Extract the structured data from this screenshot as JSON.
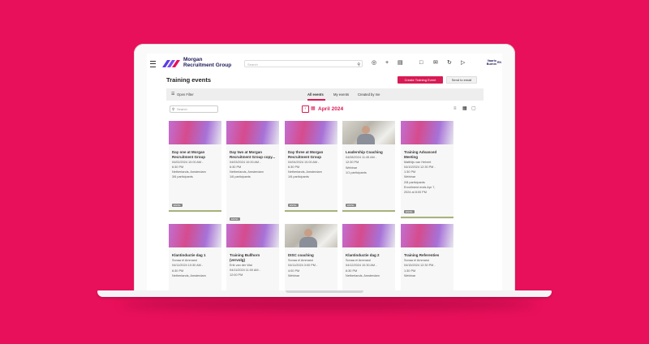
{
  "app": {
    "logo_line1": "Morgan",
    "logo_line2": "Recruitment Group",
    "search_placeholder": "Search",
    "user_line1": "Vaarlo",
    "user_line2": "Burnin",
    "language": "EN"
  },
  "header": {
    "title": "Training events",
    "create_label": "Create Training Event",
    "send_label": "Send to email"
  },
  "filter": {
    "open_filter": "Open Filter",
    "tabs": [
      "All events",
      "My events",
      "Created by me"
    ],
    "active_tab": 0
  },
  "toolbar": {
    "search_placeholder": "Search",
    "month": "April 2024"
  },
  "colors": {
    "accent": "#d81b55",
    "background": "#e8105a"
  },
  "cards": [
    {
      "title": "Day one at Morgan Recruitment Group",
      "lines": [
        "04/02/2024 10:00 AM -",
        "6:30 PM",
        "Netherlands, Amsterdam",
        "3/6 participants"
      ],
      "badge": "EN/NL",
      "image": "gradient"
    },
    {
      "title": "Day two at Morgan Recruitment Group copy...",
      "lines": [
        "04/03/2024 10:00 AM -",
        "6:30 PM",
        "Netherlands, Amsterdam",
        "1/6 participants"
      ],
      "badge": "EN/NL",
      "image": "gradient"
    },
    {
      "title": "Day three at Morgan Recruitment Group",
      "lines": [
        "04/04/2024 10:00 AM -",
        "6:30 PM",
        "Netherlands, Amsterdam",
        "1/6 participants"
      ],
      "badge": "EN/NL",
      "image": "gradient"
    },
    {
      "title": "Leadership Coaching",
      "lines": [
        "04/08/2024 11:45 AM -",
        "12:30 PM",
        "Webinar",
        "1/1 participants"
      ],
      "badge": "EN/NL",
      "image": "photo"
    },
    {
      "title": "Training Advanced Meeting",
      "lines": [
        "Matthijs van Helvert",
        "04/10/2024 12:30 PM -",
        "1:30 PM",
        "Webinar",
        "2/8 participants",
        "Enrollment ends Apr 7,",
        "2024 at 8:00 PM"
      ],
      "badge": "EN/NL",
      "image": "gradient"
    },
    {
      "title": "Klantinductie dag 1",
      "lines": [
        "Sonaa el Ammaroi",
        "04/11/2024 10:30 AM -",
        "6:30 PM",
        "Netherlands, Amsterdam"
      ],
      "badge": "",
      "image": "gradient"
    },
    {
      "title": "Training Bullhorn (vervolg)",
      "lines": [
        "Erik van der Wal",
        "04/11/2024 11:00 AM -",
        "12:00 PM"
      ],
      "badge": "",
      "image": "gradient"
    },
    {
      "title": "DISC coaching",
      "lines": [
        "Sonaa el Ammaroi",
        "04/11/2024 3:00 PM -",
        "4:00 PM",
        "Webinar"
      ],
      "badge": "",
      "image": "photo"
    },
    {
      "title": "Klantinductie dag 2",
      "lines": [
        "Sonaa el Ammaroi",
        "04/12/2024 10:30 AM -",
        "6:30 PM",
        "Netherlands, Amsterdam"
      ],
      "badge": "",
      "image": "gradient"
    },
    {
      "title": "Training Referenties",
      "lines": [
        "Sonaa el Ammaroi",
        "04/15/2024 12:30 PM -",
        "1:30 PM",
        "Webinar"
      ],
      "badge": "",
      "image": "gradient"
    }
  ]
}
